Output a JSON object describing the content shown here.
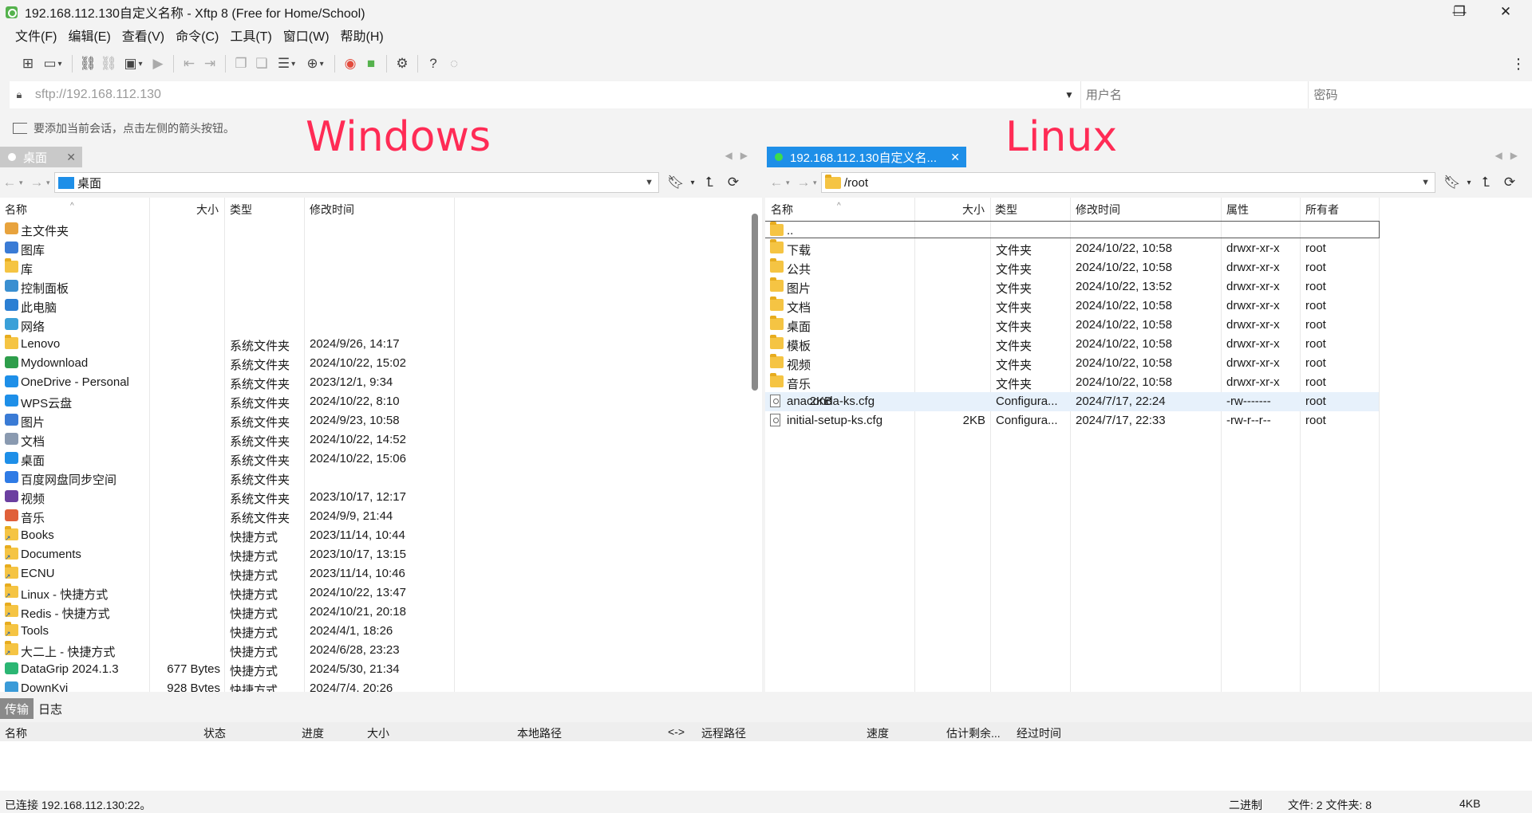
{
  "window": {
    "title": "192.168.112.130自定义名称 - Xftp 8 (Free for Home/School)",
    "minimize": "—",
    "maximize": "❐",
    "close": "✕"
  },
  "menu": [
    "文件(F)",
    "编辑(E)",
    "查看(V)",
    "命令(C)",
    "工具(T)",
    "窗口(W)",
    "帮助(H)"
  ],
  "address": {
    "value": "sftp://192.168.112.130",
    "username_placeholder": "用户名",
    "password_placeholder": "密码"
  },
  "hint": "要添加当前会话，点击左侧的箭头按钮。",
  "annotations": {
    "left": "Windows",
    "right": "Linux"
  },
  "left_pane": {
    "tab": "桌面",
    "path": "桌面",
    "columns": [
      "名称",
      "大小",
      "类型",
      "修改时间"
    ],
    "rows": [
      {
        "name": "主文件夹",
        "size": "",
        "type": "",
        "mtime": "",
        "icon": "home-icon"
      },
      {
        "name": "图库",
        "size": "",
        "type": "",
        "mtime": "",
        "icon": "gallery-icon"
      },
      {
        "name": "库",
        "size": "",
        "type": "",
        "mtime": "",
        "icon": "folder-icon"
      },
      {
        "name": "控制面板",
        "size": "",
        "type": "",
        "mtime": "",
        "icon": "control-panel-icon"
      },
      {
        "name": "此电脑",
        "size": "",
        "type": "",
        "mtime": "",
        "icon": "computer-icon"
      },
      {
        "name": "网络",
        "size": "",
        "type": "",
        "mtime": "",
        "icon": "network-icon"
      },
      {
        "name": "Lenovo",
        "size": "",
        "type": "系统文件夹",
        "mtime": "2024/9/26, 14:17",
        "icon": "folder-icon"
      },
      {
        "name": "Mydownload",
        "size": "",
        "type": "系统文件夹",
        "mtime": "2024/10/22, 15:02",
        "icon": "download-icon"
      },
      {
        "name": "OneDrive - Personal",
        "size": "",
        "type": "系统文件夹",
        "mtime": "2023/12/1, 9:34",
        "icon": "cloud-icon"
      },
      {
        "name": "WPS云盘",
        "size": "",
        "type": "系统文件夹",
        "mtime": "2024/10/22, 8:10",
        "icon": "cloud-icon"
      },
      {
        "name": "图片",
        "size": "",
        "type": "系统文件夹",
        "mtime": "2024/9/23, 10:58",
        "icon": "pictures-icon"
      },
      {
        "name": "文档",
        "size": "",
        "type": "系统文件夹",
        "mtime": "2024/10/22, 14:52",
        "icon": "documents-icon"
      },
      {
        "name": "桌面",
        "size": "",
        "type": "系统文件夹",
        "mtime": "2024/10/22, 15:06",
        "icon": "desktop-icon"
      },
      {
        "name": "百度网盘同步空间",
        "size": "",
        "type": "系统文件夹",
        "mtime": "",
        "icon": "baidu-sync-icon"
      },
      {
        "name": "视频",
        "size": "",
        "type": "系统文件夹",
        "mtime": "2023/10/17, 12:17",
        "icon": "videos-icon"
      },
      {
        "name": "音乐",
        "size": "",
        "type": "系统文件夹",
        "mtime": "2024/9/9, 21:44",
        "icon": "music-icon"
      },
      {
        "name": "Books",
        "size": "",
        "type": "快捷方式",
        "mtime": "2023/11/14, 10:44",
        "icon": "shortcut-folder-icon"
      },
      {
        "name": "Documents",
        "size": "",
        "type": "快捷方式",
        "mtime": "2023/10/17, 13:15",
        "icon": "shortcut-folder-icon"
      },
      {
        "name": "ECNU",
        "size": "",
        "type": "快捷方式",
        "mtime": "2023/11/14, 10:46",
        "icon": "shortcut-folder-icon"
      },
      {
        "name": "Linux - 快捷方式",
        "size": "",
        "type": "快捷方式",
        "mtime": "2024/10/22, 13:47",
        "icon": "shortcut-folder-icon"
      },
      {
        "name": "Redis - 快捷方式",
        "size": "",
        "type": "快捷方式",
        "mtime": "2024/10/21, 20:18",
        "icon": "shortcut-folder-icon"
      },
      {
        "name": "Tools",
        "size": "",
        "type": "快捷方式",
        "mtime": "2024/4/1, 18:26",
        "icon": "shortcut-folder-icon"
      },
      {
        "name": "大二上 - 快捷方式",
        "size": "",
        "type": "快捷方式",
        "mtime": "2024/6/28, 23:23",
        "icon": "shortcut-folder-icon"
      },
      {
        "name": "DataGrip 2024.1.3",
        "size": "677 Bytes",
        "type": "快捷方式",
        "mtime": "2024/5/30, 21:34",
        "icon": "datagrip-icon"
      },
      {
        "name": "DownKyi",
        "size": "928 Bytes",
        "type": "快捷方式",
        "mtime": "2024/7/4, 20:26",
        "icon": "downkyi-icon"
      }
    ]
  },
  "right_pane": {
    "tab": "192.168.112.130自定义名...",
    "path": "/root",
    "columns": [
      "名称",
      "大小",
      "类型",
      "修改时间",
      "属性",
      "所有者"
    ],
    "rows": [
      {
        "name": "..",
        "size": "",
        "type": "",
        "mtime": "",
        "attr": "",
        "owner": "",
        "icon": "folder-icon"
      },
      {
        "name": "下载",
        "size": "",
        "type": "文件夹",
        "mtime": "2024/10/22, 10:58",
        "attr": "drwxr-xr-x",
        "owner": "root",
        "icon": "folder-icon"
      },
      {
        "name": "公共",
        "size": "",
        "type": "文件夹",
        "mtime": "2024/10/22, 10:58",
        "attr": "drwxr-xr-x",
        "owner": "root",
        "icon": "folder-icon"
      },
      {
        "name": "图片",
        "size": "",
        "type": "文件夹",
        "mtime": "2024/10/22, 13:52",
        "attr": "drwxr-xr-x",
        "owner": "root",
        "icon": "folder-icon"
      },
      {
        "name": "文档",
        "size": "",
        "type": "文件夹",
        "mtime": "2024/10/22, 10:58",
        "attr": "drwxr-xr-x",
        "owner": "root",
        "icon": "folder-icon"
      },
      {
        "name": "桌面",
        "size": "",
        "type": "文件夹",
        "mtime": "2024/10/22, 10:58",
        "attr": "drwxr-xr-x",
        "owner": "root",
        "icon": "folder-icon"
      },
      {
        "name": "模板",
        "size": "",
        "type": "文件夹",
        "mtime": "2024/10/22, 10:58",
        "attr": "drwxr-xr-x",
        "owner": "root",
        "icon": "folder-icon"
      },
      {
        "name": "视频",
        "size": "",
        "type": "文件夹",
        "mtime": "2024/10/22, 10:58",
        "attr": "drwxr-xr-x",
        "owner": "root",
        "icon": "folder-icon"
      },
      {
        "name": "音乐",
        "size": "",
        "type": "文件夹",
        "mtime": "2024/10/22, 10:58",
        "attr": "drwxr-xr-x",
        "owner": "root",
        "icon": "folder-icon"
      },
      {
        "name": "anaconda-ks.cfg",
        "size": "2KB",
        "type": "Configura...",
        "mtime": "2024/7/17, 22:24",
        "attr": "-rw-------",
        "owner": "root",
        "icon": "config-file-icon"
      },
      {
        "name": "initial-setup-ks.cfg",
        "size": "2KB",
        "type": "Configura...",
        "mtime": "2024/7/17, 22:33",
        "attr": "-rw-r--r--",
        "owner": "root",
        "icon": "config-file-icon"
      }
    ]
  },
  "bottom": {
    "tabs": [
      "传输",
      "日志"
    ],
    "columns": [
      "名称",
      "状态",
      "进度",
      "大小",
      "本地路径",
      "<->",
      "远程路径",
      "速度",
      "估计剩余...",
      "经过时间"
    ]
  },
  "status": {
    "connection": "已连接 192.168.112.130:22。",
    "mode": "二进制",
    "counts": "文件: 2  文件夹: 8",
    "size": "4KB"
  },
  "colors": {
    "accent": "#1e8fe8",
    "annotation": "#ff2b55",
    "folder": "#f5c443"
  }
}
